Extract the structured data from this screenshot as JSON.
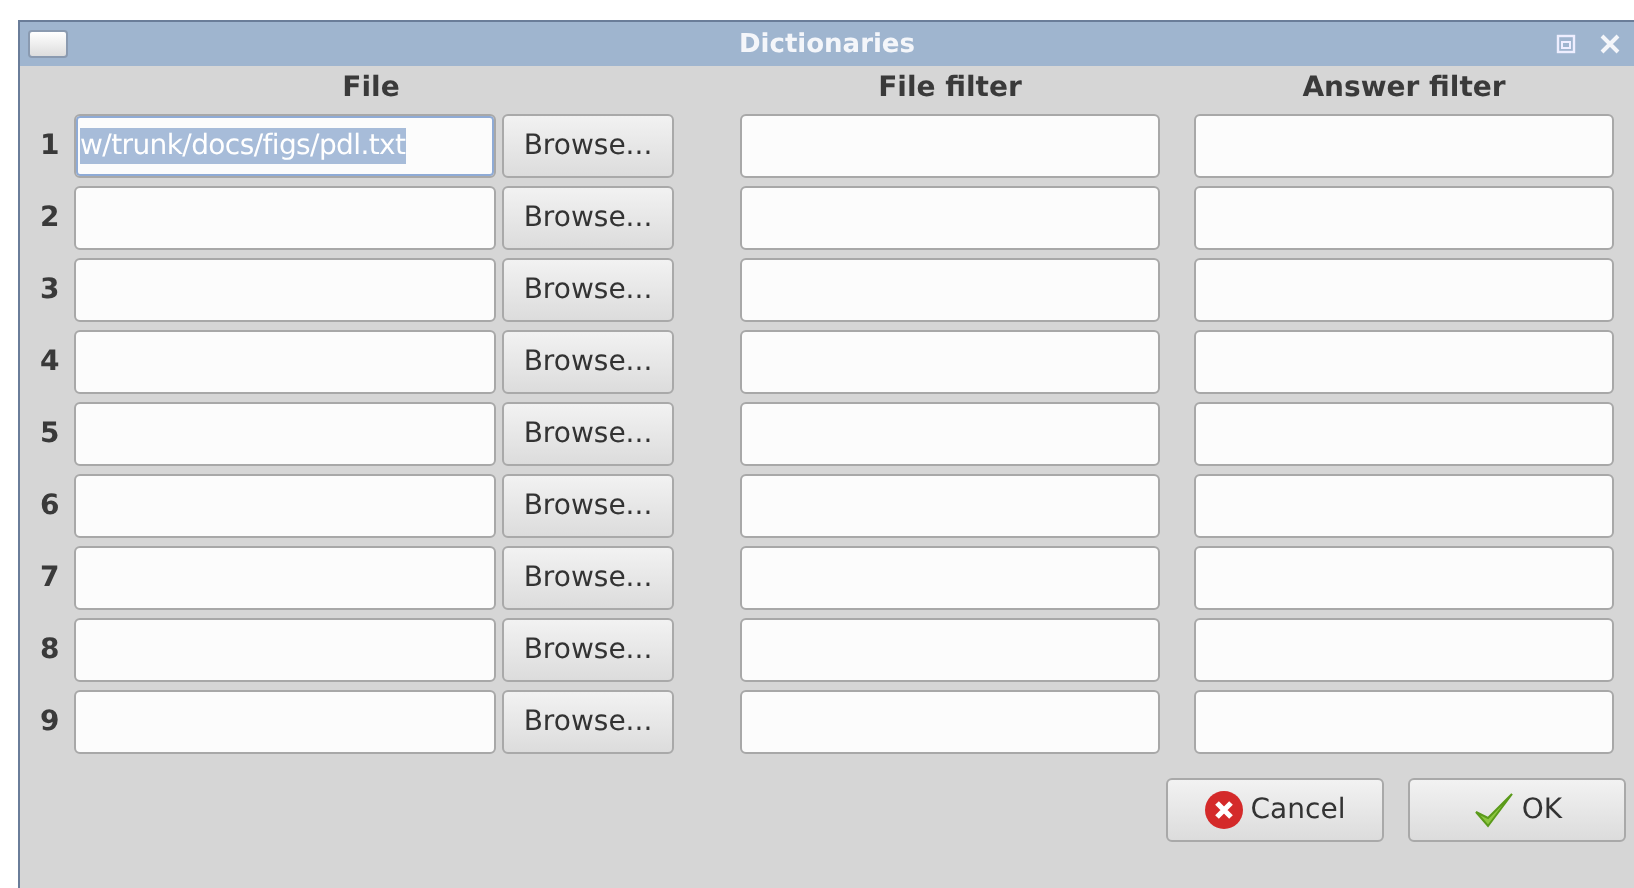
{
  "window": {
    "title": "Dictionaries"
  },
  "columns": {
    "file": "File",
    "file_filter": "File filter",
    "answer_filter": "Answer filter"
  },
  "rows": [
    {
      "number": "1",
      "file": "w/trunk/docs/figs/pdl.txt",
      "file_selected": true,
      "browse": "Browse..."
    },
    {
      "number": "2",
      "file_selected": false,
      "browse": "Browse..."
    },
    {
      "number": "3",
      "file_selected": false,
      "browse": "Browse..."
    },
    {
      "number": "4",
      "file_selected": false,
      "browse": "Browse..."
    },
    {
      "number": "5",
      "file_selected": false,
      "browse": "Browse..."
    },
    {
      "number": "6",
      "file_selected": false,
      "browse": "Browse..."
    },
    {
      "number": "7",
      "file_selected": false,
      "browse": "Browse..."
    },
    {
      "number": "8",
      "file_selected": false,
      "browse": "Browse..."
    },
    {
      "number": "9",
      "file_selected": false,
      "browse": "Browse..."
    }
  ],
  "buttons": {
    "cancel": "Cancel",
    "ok": "OK"
  }
}
